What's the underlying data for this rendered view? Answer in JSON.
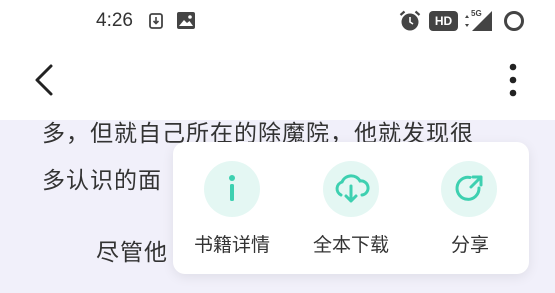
{
  "status_bar": {
    "time": "4:26",
    "hd_badge": "HD",
    "network": "5G",
    "icons": [
      "download-icon",
      "image-icon",
      "alarm-icon",
      "hd-icon",
      "signal-icon",
      "circle-icon"
    ]
  },
  "app_bar": {
    "back_icon": "back-arrow-icon",
    "more_icon": "more-vertical-icon"
  },
  "content": {
    "lines": [
      "多，但就自己所在的除魔院，他就发现很",
      "多认识的面",
      "尽管他"
    ]
  },
  "popup": {
    "accent_color": "#3dd0b0",
    "actions": [
      {
        "label": "书籍详情",
        "icon": "info-icon"
      },
      {
        "label": "全本下载",
        "icon": "cloud-download-icon"
      },
      {
        "label": "分享",
        "icon": "share-icon"
      }
    ]
  }
}
